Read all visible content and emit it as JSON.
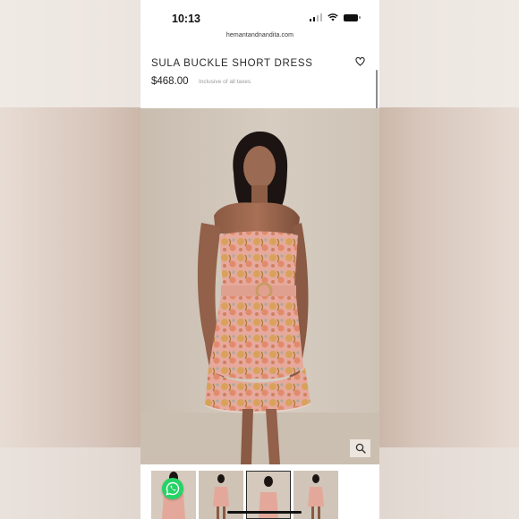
{
  "status_bar": {
    "time": "10:13"
  },
  "browser": {
    "url": "hemantandnandita.com"
  },
  "product": {
    "title": "SULA BUCKLE SHORT DRESS",
    "price": "$468.00",
    "tax_note": "Inclusive of all taxes"
  },
  "icons": {
    "wishlist": "heart-outline-icon",
    "zoom": "magnifier-icon",
    "chat": "whatsapp-icon",
    "wifi": "wifi-icon",
    "battery": "battery-icon",
    "signal": "signal-icon"
  },
  "thumbnails": {
    "count": 4,
    "active_index": 2
  },
  "colors": {
    "dress_pink": "#e5a79c",
    "whatsapp_green": "#25d366",
    "title_text": "#2a2a2a"
  }
}
